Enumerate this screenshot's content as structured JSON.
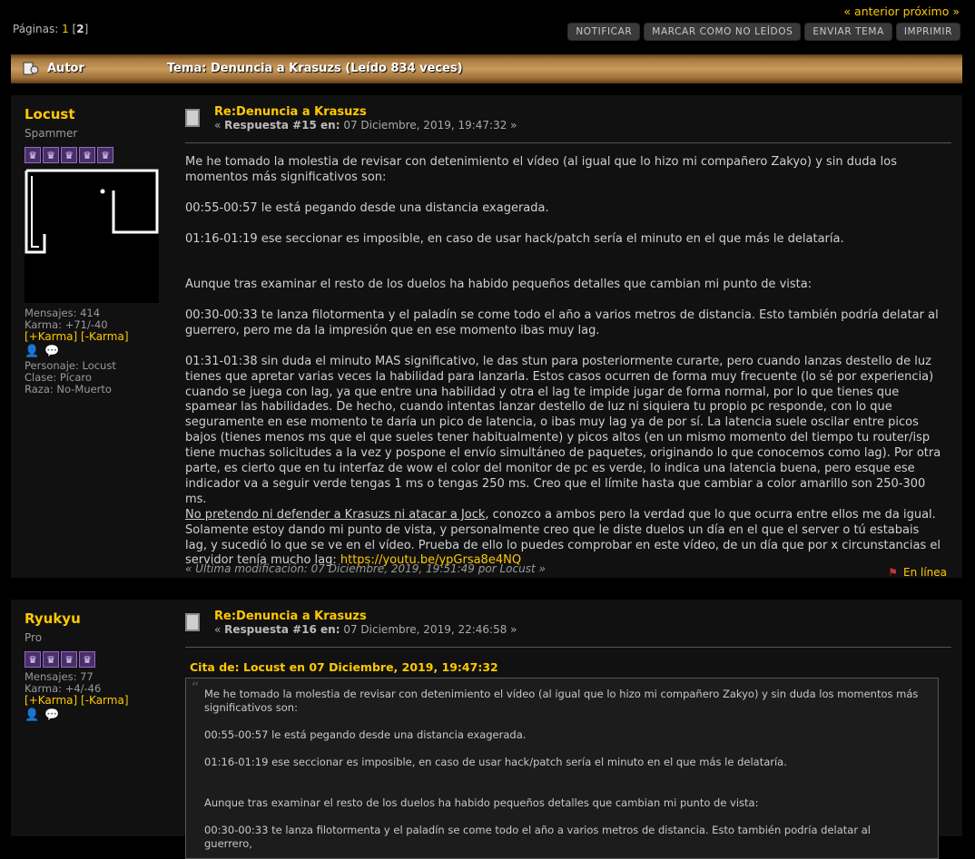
{
  "nav": {
    "prev": "« anterior",
    "next": "próximo »"
  },
  "pages": {
    "label": "Páginas:",
    "page1": "1",
    "page2": "2"
  },
  "actions": [
    "NOTIFICAR",
    "MARCAR COMO NO LEÍDOS",
    "ENVIAR TEMA",
    "IMPRIMIR"
  ],
  "header": {
    "author": "Autor",
    "topic": "Tema: Denuncia a Krasuzs  (Leído 834 veces)"
  },
  "posts": [
    {
      "name": "Locust",
      "rank": "Spammer",
      "stars": 5,
      "messages": "Mensajes: 414",
      "karma": "Karma: +71/-40",
      "karma_plus": "[+Karma]",
      "karma_minus": "[-Karma]",
      "character": "Personaje: Locust",
      "class": "Clase: Pícaro",
      "race": "Raza: No-Muerto",
      "subject": "Re:Denuncia a Krasuzs",
      "reply_label": "Respuesta #15 en:",
      "date": "07 Diciembre, 2019, 19:47:32 »",
      "p1": "Me he tomado la molestia de revisar con detenimiento el vídeo (al igual que lo hizo mi compañero Zakyo) y sin duda los momentos más significativos son:",
      "p2": "00:55-00:57 le está pegando desde una distancia exagerada.",
      "p3": "01:16-01:19 ese seccionar es imposible, en caso de usar hack/patch sería el minuto en el que más le delataría.",
      "p4": "Aunque tras examinar el resto de los duelos ha habido pequeños detalles que cambian mi punto de vista:",
      "p5": "00:30-00:33 te lanza filotormenta y el paladín se come todo el año a varios metros de distancia. Esto también podría delatar al guerrero, pero me da la impresión que en ese momento ibas muy lag.",
      "p6": "01:31-01:38 sin duda el minuto MAS significativo, le das stun para posteriormente curarte, pero cuando lanzas destello de luz tienes que apretar varias veces la habilidad para lanzarla. Estos casos ocurren de forma muy frecuente (lo sé por experiencia) cuando se juega con lag, ya que entre una habilidad y otra el lag te impide jugar de forma normal, por lo que tienes que spamear las habilidades. De hecho, cuando intentas lanzar destello de luz ni siquiera tu propio pc responde, con lo que seguramente en ese momento te daría un pico de latencia, o ibas muy lag ya de por sí. La latencia suele oscilar entre picos bajos (tienes menos ms que el que sueles tener habitualmente) y picos altos (en un mismo momento del tiempo tu router/isp tiene muchas solicitudes a la vez y pospone el envío simultáneo de paquetes, originando lo que conocemos como lag). Por otra parte, es cierto que en tu interfaz de wow el color del monitor de pc es verde, lo indica una latencia buena, pero esque ese indicador va a seguir verde tengas 1 ms o tengas 250 ms. Creo que el límite hasta que cambiar a color amarillo son 250-300 ms.",
      "p7_underline": "No pretendo ni defender a Krasuzs ni atacar a Jock",
      "p7_rest": ", conozco a ambos pero la verdad que lo que ocurra entre ellos me da igual. Solamente estoy dando mi punto de vista, y personalmente creo que le diste duelos un día en el que el server o tú estabais lag, y sucedió lo que se ve en el vídeo. Prueba de ello lo puedes comprobar en este vídeo, de un día que por x circunstancias el servidor tenía mucho lag: ",
      "link": "https://youtu.be/ypGrsa8e4NQ",
      "lastmod": "« Última modificación: 07 Diciembre, 2019, 19:51:49 por Locust »",
      "status": "En línea"
    },
    {
      "name": "Ryukyu",
      "rank": "Pro",
      "stars": 4,
      "messages": "Mensajes: 77",
      "karma": "Karma: +4/-46",
      "karma_plus": "[+Karma]",
      "karma_minus": "[-Karma]",
      "subject": "Re:Denuncia a Krasuzs",
      "reply_label": "Respuesta #16 en:",
      "date": "07 Diciembre, 2019, 22:46:58 »",
      "quote_head": "Cita de: Locust en 07 Diciembre, 2019, 19:47:32",
      "q1": "Me he tomado la molestia de revisar con detenimiento el vídeo (al igual que lo hizo mi compañero Zakyo) y sin duda los momentos más significativos son:",
      "q2": "00:55-00:57 le está pegando desde una distancia exagerada.",
      "q3": "01:16-01:19 ese seccionar es imposible, en caso de usar hack/patch sería el minuto en el que más le delataría.",
      "q4": "Aunque tras examinar el resto de los duelos ha habido pequeños detalles que cambian mi punto de vista:",
      "q5": "00:30-00:33 te lanza filotormenta y el paladín se come todo el año a varios metros de distancia. Esto también podría delatar al guerrero,"
    }
  ]
}
